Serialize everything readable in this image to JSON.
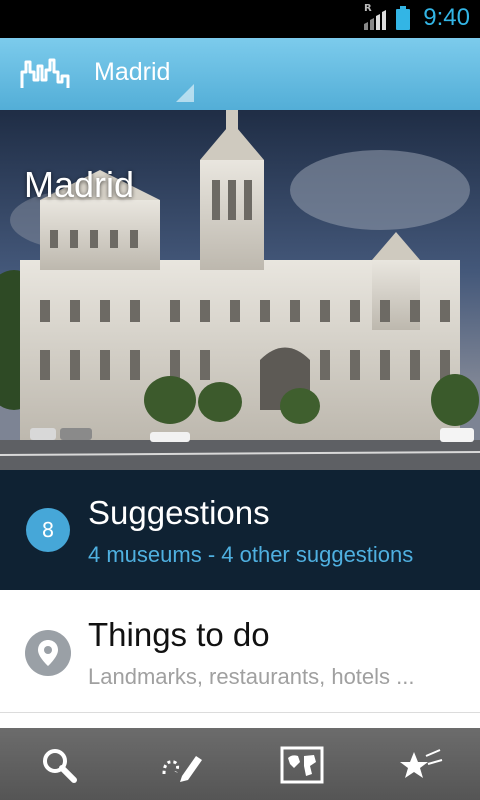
{
  "status_bar": {
    "time": "9:40",
    "roaming_indicator": "R",
    "icons": [
      "signal-icon",
      "battery-icon"
    ],
    "accent_color": "#33b5e5"
  },
  "action_bar": {
    "logo_icon": "city-skyline-logo-icon",
    "city_selector_value": "Madrid",
    "background_color": "#5fb9df"
  },
  "hero": {
    "title": "Madrid",
    "image_description_icon": "cibeles-palace-photo"
  },
  "suggestions": {
    "count": "8",
    "title": "Suggestions",
    "subtitle": "4 museums - 4 other suggestions",
    "background_color": "#0f2233",
    "accent_color": "#4fb0e0"
  },
  "things_to_do": {
    "icon": "map-pin-icon",
    "title": "Things to do",
    "subtitle": "Landmarks, restaurants, hotels ..."
  },
  "bottom_bar": {
    "tabs": [
      {
        "icon": "search-icon"
      },
      {
        "icon": "edit-route-icon"
      },
      {
        "icon": "world-map-icon"
      },
      {
        "icon": "favorites-stars-icon"
      }
    ]
  }
}
